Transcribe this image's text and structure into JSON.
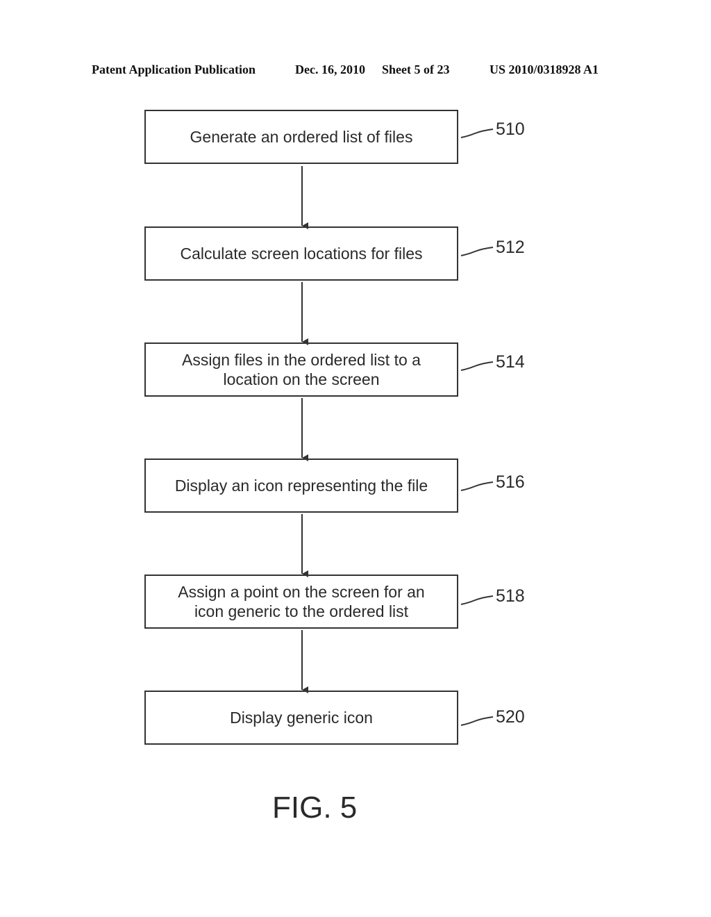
{
  "header": {
    "publication": "Patent Application Publication",
    "date": "Dec. 16, 2010",
    "sheet": "Sheet 5 of 23",
    "number": "US 2010/0318928 A1"
  },
  "steps": [
    {
      "label": "Generate an ordered list of files",
      "ref": "510"
    },
    {
      "label": "Calculate screen locations for files",
      "ref": "512"
    },
    {
      "label": "Assign files in the ordered list to a location on the screen",
      "ref": "514"
    },
    {
      "label": "Display an icon representing the file",
      "ref": "516"
    },
    {
      "label": "Assign a point on the screen for an icon generic to the ordered list",
      "ref": "518"
    },
    {
      "label": "Display generic icon",
      "ref": "520"
    }
  ],
  "figure_label": "FIG. 5"
}
